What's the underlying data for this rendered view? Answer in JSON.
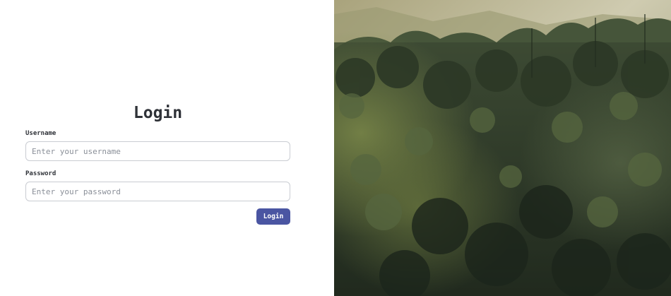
{
  "login": {
    "title": "Login",
    "username_label": "Username",
    "username_placeholder": "Enter your username",
    "password_label": "Password",
    "password_placeholder": "Enter your password",
    "submit_label": "Login"
  },
  "colors": {
    "accent": "#4a55a2",
    "text": "#2f3238",
    "border": "#c9ccd2"
  },
  "background_image": {
    "icon": "forest-photo"
  }
}
